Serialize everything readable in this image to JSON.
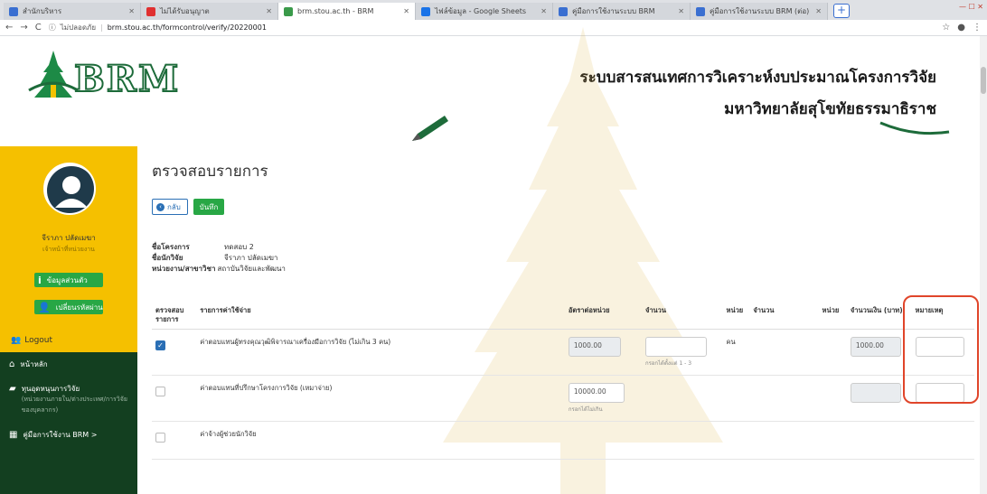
{
  "browser": {
    "tabs": [
      {
        "title": "สำนักบริหาร",
        "active": false
      },
      {
        "title": "ไม่ได้รับอนุญาต",
        "active": false
      },
      {
        "title": "brm.stou.ac.th - BRM",
        "active": true
      },
      {
        "title": "ไฟล์ข้อมูล - Google Sheets",
        "active": false
      },
      {
        "title": "คู่มือการใช้งานระบบ BRM",
        "active": false
      },
      {
        "title": "คู่มือการใช้งานระบบ BRM (ต่อ)",
        "active": false
      }
    ],
    "window_controls": "— ☐ ✕",
    "security_label": "ไม่ปลอดภัย",
    "url": "brm.stou.ac.th/formcontrol/verify/20220001"
  },
  "header": {
    "logo_text": "BRM",
    "title_line1": "ระบบสารสนเทศการวิเคราะห์งบประมาณโครงการวิจัย",
    "title_line2": "มหาวิทยาลัยสุโขทัยธรรมาธิราช"
  },
  "sidebar": {
    "user_name": "จีราภา ปลัดเมฆา",
    "user_role": "เจ้าหน้าที่หน่วยงาน",
    "btn_info": "ข้อมูลส่วนตัว",
    "btn_change": "เปลี่ยนรหัสผ่าน",
    "logout": "Logout",
    "menu": [
      {
        "icon": "⌂",
        "label": "หน้าหลัก",
        "sub": ""
      },
      {
        "icon": "▰",
        "label": "ทุนอุดหนุนการวิจัย",
        "sub": "(หน่วยงานภายใน/ต่างประเทศ/การวิจัยของบุคลากร)"
      },
      {
        "icon": "▦",
        "label": "คู่มือการใช้งาน BRM  >",
        "sub": ""
      }
    ]
  },
  "main": {
    "page_title": "ตรวจสอบรายการ",
    "back_label": "กลับ",
    "save_label": "บันทึก",
    "info": [
      {
        "k": "ชื่อโครงการ",
        "v": "ทดสอบ 2"
      },
      {
        "k": "ชื่อนักวิจัย",
        "v": "จีราภา ปลัดเมฆา"
      },
      {
        "k": "หน่วยงาน/สาขาวิชา",
        "v": "สถาบันวิจัยและพัฒนา"
      }
    ],
    "columns": [
      "ตรวจสอบรายการ",
      "รายการค่าใช้จ่าย",
      "อัตราต่อหน่วย",
      "จำนวน",
      "หน่วย",
      "จำนวน",
      "หน่วย",
      "จำนวนเงิน (บาท)",
      "หมายเหตุ"
    ],
    "rows": [
      {
        "checked": true,
        "item": "ค่าตอบแทนผู้ทรงคุณวุฒิพิจารณาเครื่องมือการวิจัย (ไม่เกิน 3 คน)",
        "rate": "1000.00",
        "rate_hint": "",
        "qty": "",
        "qty_hint": "กรอกได้ตั้งแต่ 1 - 3",
        "unit": "คน",
        "amount": "1000.00"
      },
      {
        "checked": false,
        "item": "ค่าตอบแทนที่ปรึกษาโครงการวิจัย (เหมาจ่าย)",
        "rate": "10000.00",
        "rate_hint": "กรอกได้ไม่เกิน",
        "qty": "",
        "qty_hint": "",
        "unit": "",
        "amount": ""
      },
      {
        "checked": false,
        "item": "ค่าจ้างผู้ช่วยนักวิจัย",
        "rate": "",
        "rate_hint": "",
        "qty": "",
        "qty_hint": "",
        "unit": "",
        "amount": ""
      }
    ]
  },
  "colors": {
    "accent_green": "#28a745",
    "sidebar_yellow": "#f5c000",
    "menu_green": "#133f20",
    "highlight": "#e0452a",
    "link_blue": "#2a6fb5"
  }
}
